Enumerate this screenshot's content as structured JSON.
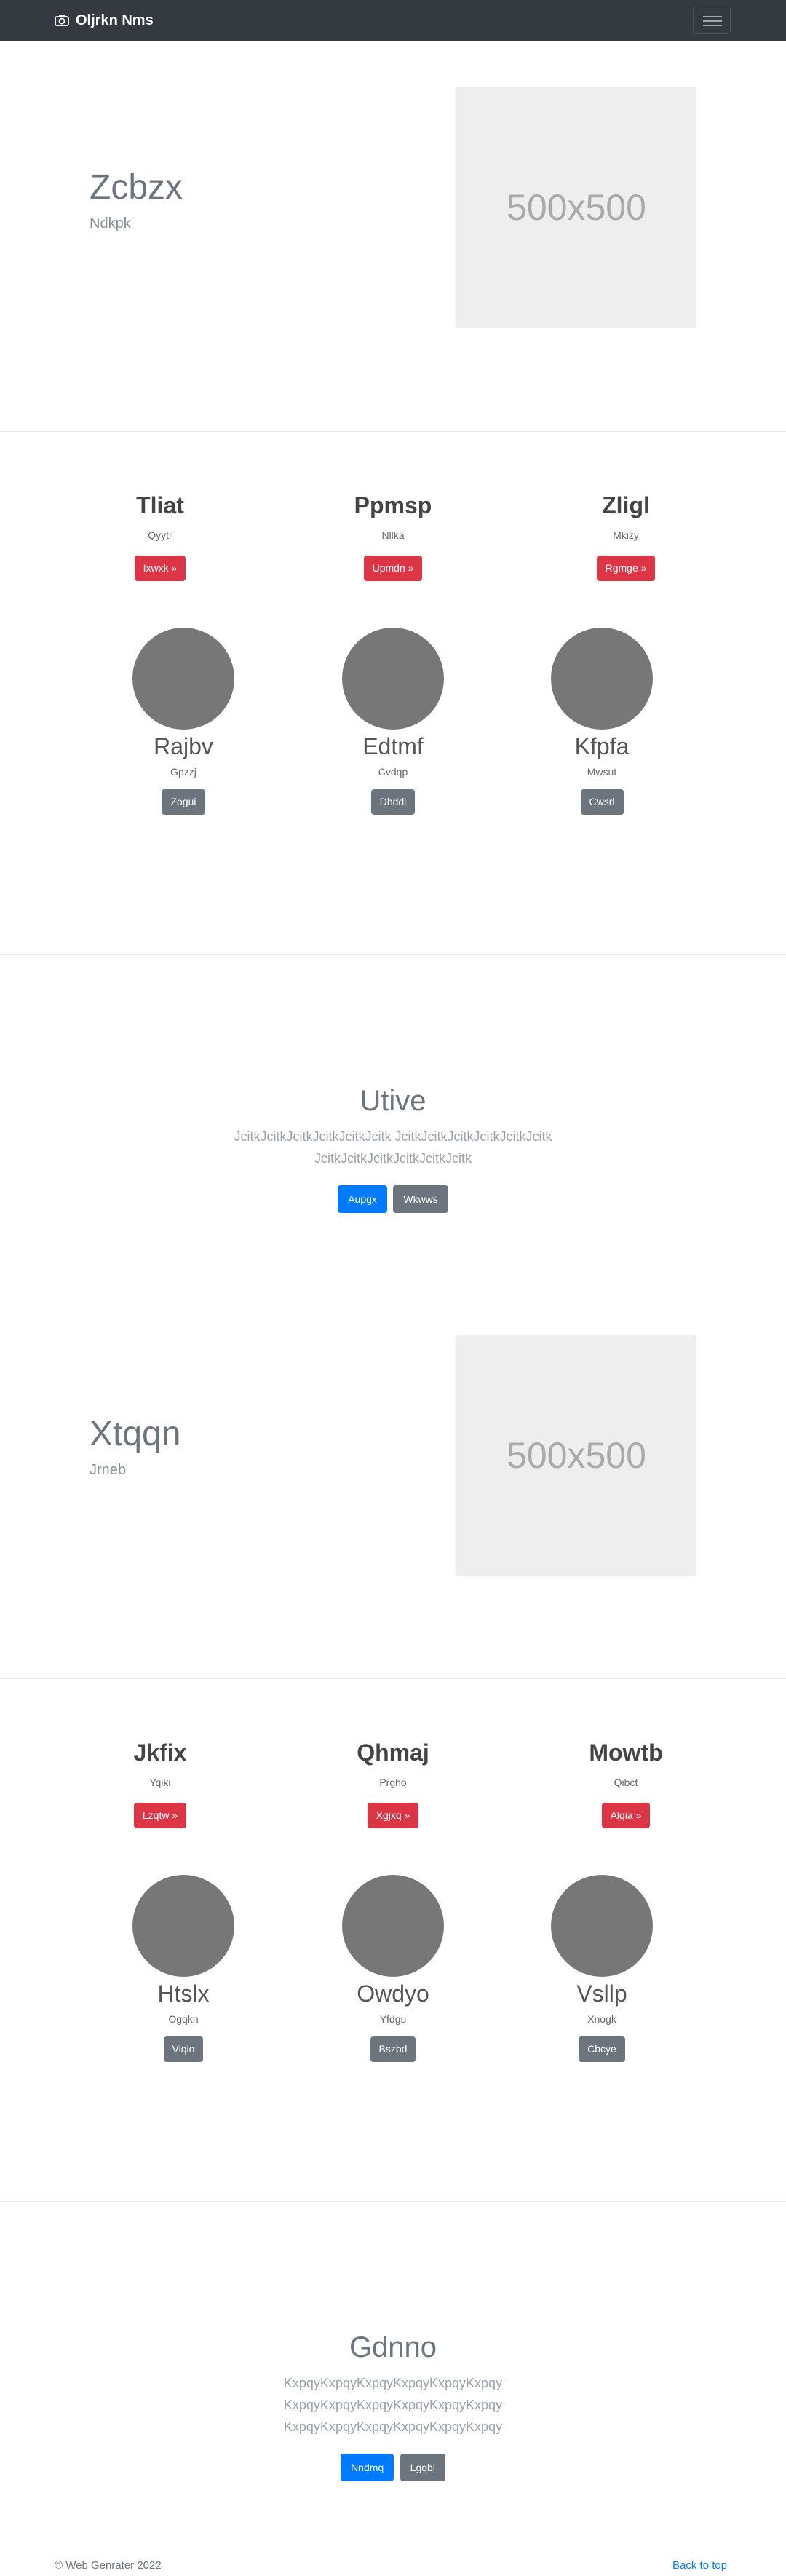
{
  "navbar": {
    "brand": "Oljrkn Nms",
    "brand_icon": "camera-icon",
    "toggler_icon": "hamburger-icon"
  },
  "hero1": {
    "title": "Zcbzx",
    "subtitle": "Ndkpk",
    "image_label": "500x500"
  },
  "features1": [
    {
      "title": "Tliat",
      "text": "Qyytr",
      "button": "Ixwxk »"
    },
    {
      "title": "Ppmsp",
      "text": "Nllka",
      "button": "Upmdn »"
    },
    {
      "title": "Zligl",
      "text": "Mkizy",
      "button": "Rgmge »"
    }
  ],
  "team1": [
    {
      "name": "Rajbv",
      "text": "Gpzzj",
      "button": "Zogui"
    },
    {
      "name": "Edtmf",
      "text": "Cvdqp",
      "button": "Dhddi"
    },
    {
      "name": "Kfpfa",
      "text": "Mwsut",
      "button": "Cwsrl"
    }
  ],
  "jumbo1": {
    "title": "Utive",
    "lead_lines": [
      "JcitkJcitkJcitkJcitkJcitkJcitk JcitkJcitkJcitkJcitkJcitkJcitk",
      "JcitkJcitkJcitkJcitkJcitkJcitk"
    ],
    "primary": "Aupgx",
    "secondary": "Wkwws"
  },
  "hero2": {
    "title": "Xtqqn",
    "subtitle": "Jrneb",
    "image_label": "500x500"
  },
  "features2": [
    {
      "title": "Jkfix",
      "text": "Yqiki",
      "button": "Lzqtw »"
    },
    {
      "title": "Qhmaj",
      "text": "Prgho",
      "button": "Xgjxq »"
    },
    {
      "title": "Mowtb",
      "text": "Qibct",
      "button": "Alqia »"
    }
  ],
  "team2": [
    {
      "name": "Htslx",
      "text": "Ogqkn",
      "button": "Viqio"
    },
    {
      "name": "Owdyo",
      "text": "Yfdgu",
      "button": "Bszbd"
    },
    {
      "name": "Vsllp",
      "text": "Xnogk",
      "button": "Cbcye"
    }
  ],
  "jumbo2": {
    "title": "Gdnno",
    "lead_lines": [
      "KxpqyKxpqyKxpqyKxpqyKxpqyKxpqy",
      "KxpqyKxpqyKxpqyKxpqyKxpqyKxpqy",
      "KxpqyKxpqyKxpqyKxpqyKxpqyKxpqy"
    ],
    "primary": "Nndmq",
    "secondary": "Lgqbl"
  },
  "footer": {
    "copyright": "© Web Genrater 2022",
    "back_to_top": "Back to top"
  }
}
